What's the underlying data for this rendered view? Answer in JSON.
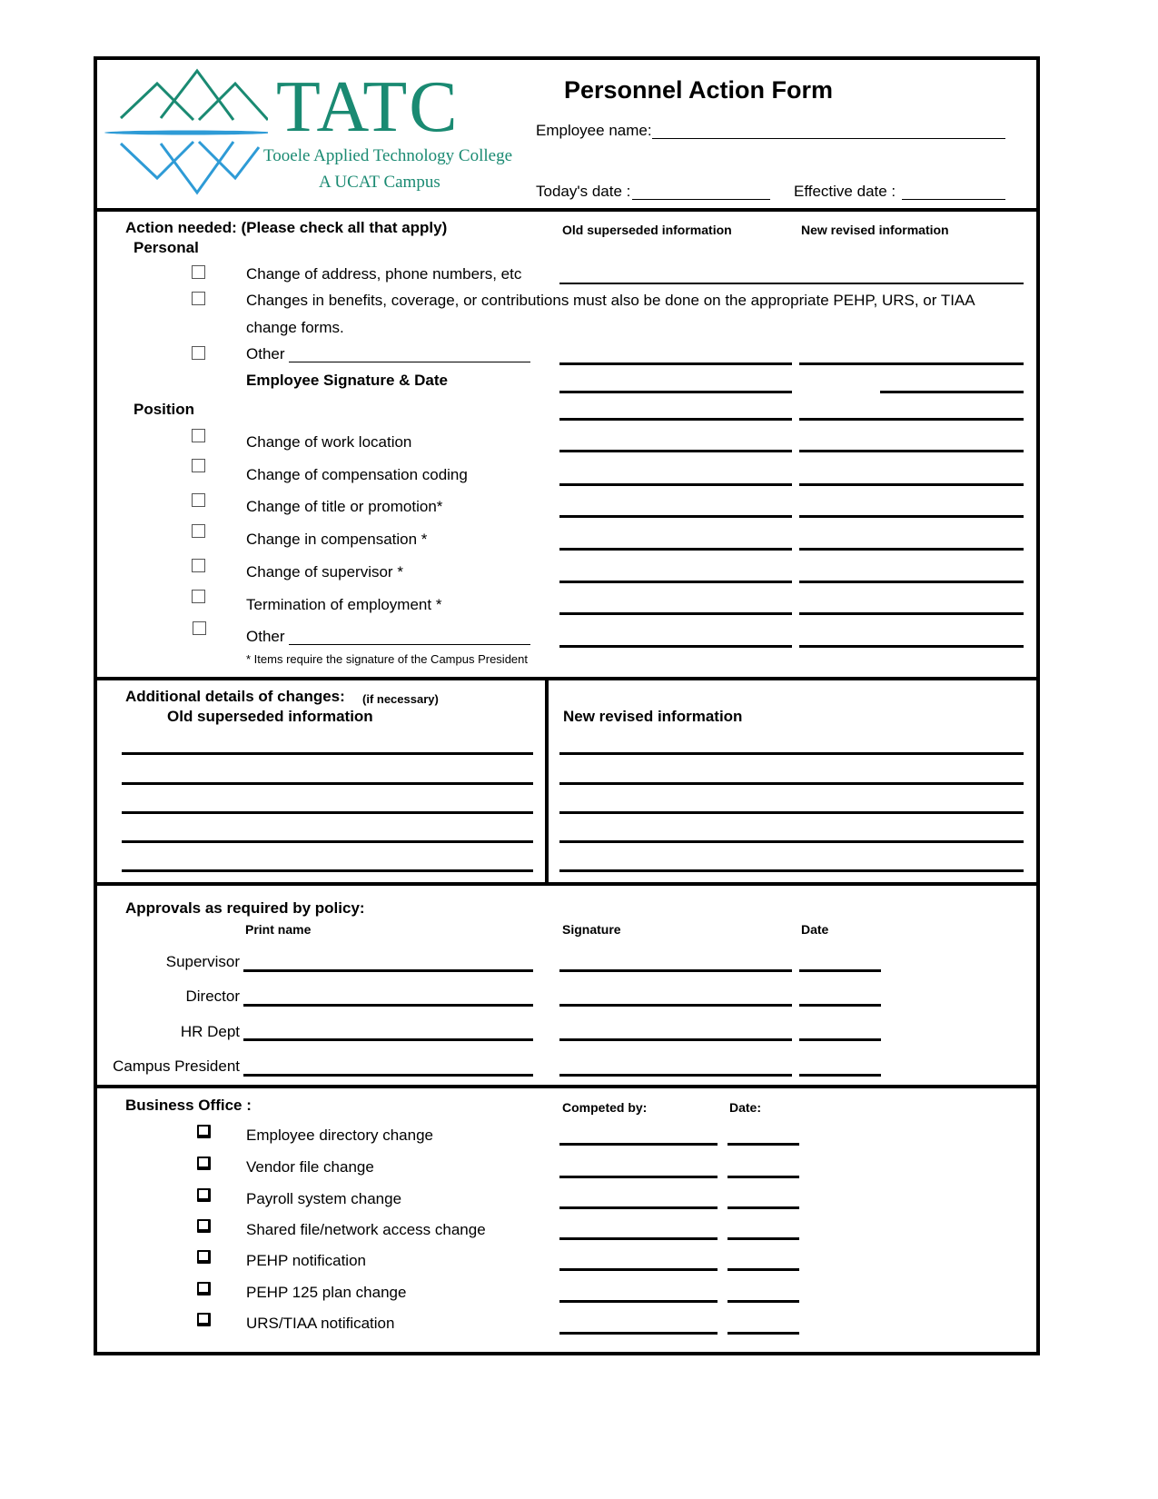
{
  "logo": {
    "acronym": "TATC",
    "college_name": "Tooele Applied Technology College",
    "campus_line": "A UCAT Campus",
    "colors": {
      "green": "#1a8a72",
      "blue": "#2e9bd6"
    }
  },
  "header": {
    "title": "Personnel Action Form",
    "employee_name_label": "Employee name:",
    "todays_date_label": "Today's date :",
    "effective_date_label": "Effective date :"
  },
  "action": {
    "heading": "Action needed: (Please check all that apply)",
    "col_old": "Old superseded information",
    "col_new": "New revised information",
    "personal": {
      "heading": "Personal",
      "items": [
        {
          "label": "Change of address, phone numbers, etc"
        },
        {
          "label": "Changes in benefits, coverage, or contributions must also be done on the appropriate PEHP, URS, or TIAA",
          "label_cont": "change forms."
        },
        {
          "label": "Other"
        }
      ],
      "signature_label": "Employee Signature & Date"
    },
    "position": {
      "heading": "Position",
      "items": [
        {
          "label": "Change of work location"
        },
        {
          "label": "Change of compensation coding"
        },
        {
          "label": "Change of title or promotion*"
        },
        {
          "label": "Change in compensation *"
        },
        {
          "label": "Change of supervisor *"
        },
        {
          "label": "Termination of employment *"
        },
        {
          "label": "Other"
        }
      ],
      "footnote": "* Items require the signature of the Campus President"
    }
  },
  "details": {
    "heading": "Additional details of changes:",
    "heading_note": "(if necessary)",
    "col_old": "Old superseded information",
    "col_new": "New revised information"
  },
  "approvals": {
    "heading": "Approvals as required by policy:",
    "col_print": "Print name",
    "col_signature": "Signature",
    "col_date": "Date",
    "rows": [
      {
        "role": "Supervisor"
      },
      {
        "role": "Director"
      },
      {
        "role": "HR Dept"
      },
      {
        "role": "Campus President"
      }
    ]
  },
  "business_office": {
    "heading": "Business Office :",
    "col_completed": "Competed by:",
    "col_date": "Date:",
    "items": [
      {
        "label": "Employee directory change"
      },
      {
        "label": "Vendor file change"
      },
      {
        "label": "Payroll system change"
      },
      {
        "label": "Shared file/network access change"
      },
      {
        "label": "PEHP notification"
      },
      {
        "label": "PEHP 125 plan change"
      },
      {
        "label": "URS/TIAA notification"
      }
    ]
  }
}
